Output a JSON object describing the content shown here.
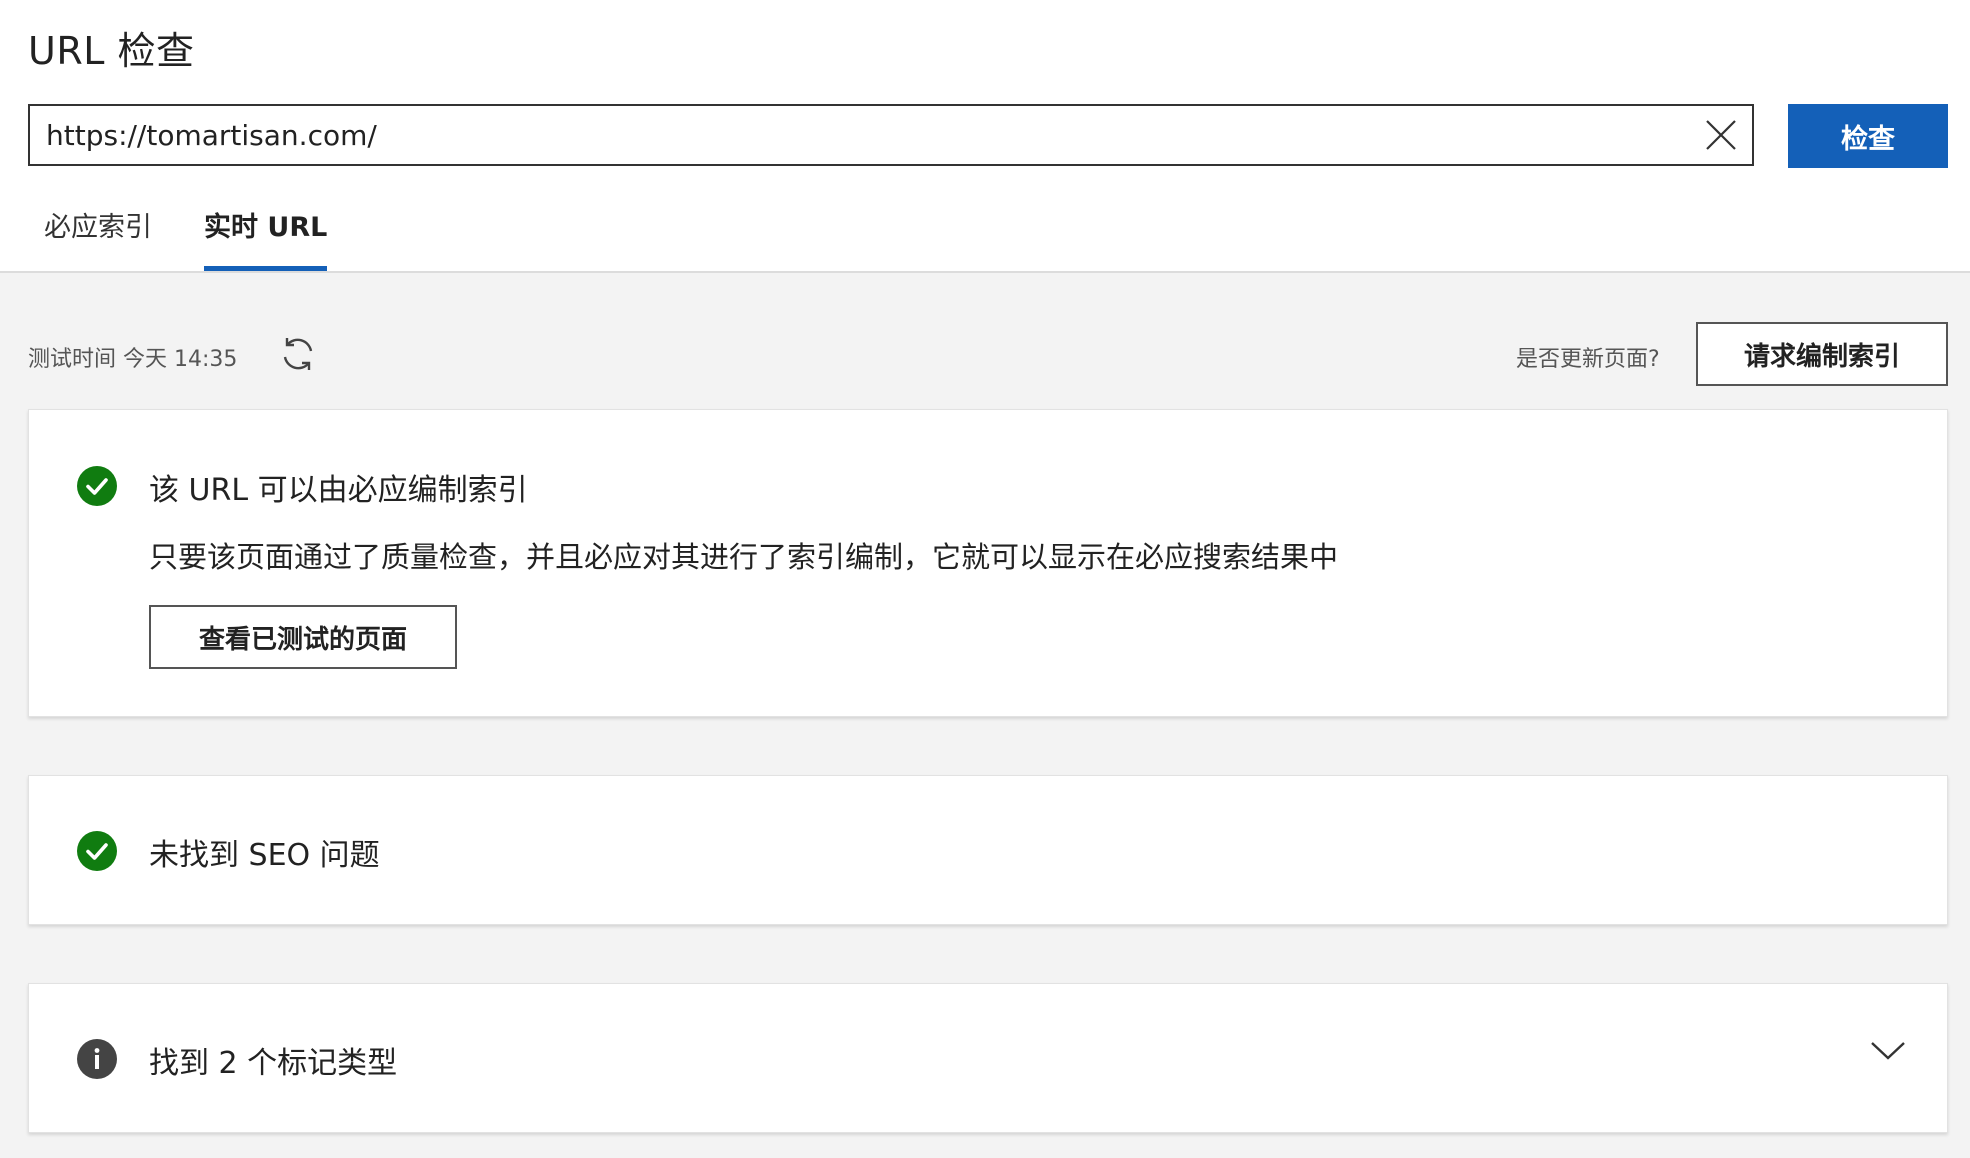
{
  "header": {
    "title": "URL 检查",
    "url_value": "https://tomartisan.com/",
    "inspect_button": "检查",
    "tabs": [
      {
        "label": "必应索引"
      },
      {
        "label": "实时 URL"
      }
    ]
  },
  "status_bar": {
    "test_time": "测试时间 今天 14:35",
    "update_question": "是否更新页面?",
    "request_button": "请求编制索引"
  },
  "cards": [
    {
      "icon": "check-circle-icon",
      "title": "该 URL 可以由必应编制索引",
      "description": "只要该页面通过了质量检查，并且必应对其进行了索引编制，它就可以显示在必应搜索结果中",
      "button": "查看已测试的页面"
    },
    {
      "icon": "check-circle-icon",
      "title": "未找到 SEO 问题"
    },
    {
      "icon": "info-icon",
      "title": "找到 2 个标记类型"
    }
  ],
  "colors": {
    "accent": "#1460b8",
    "success": "#107c10",
    "info": "#444444"
  }
}
